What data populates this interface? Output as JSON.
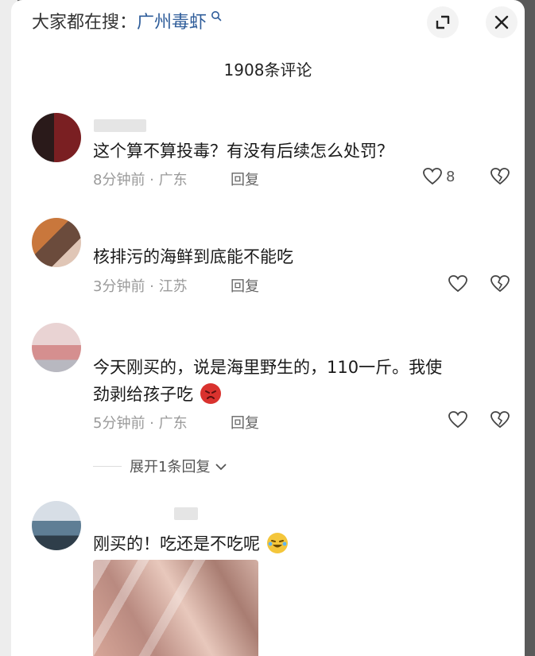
{
  "search_hint": {
    "prefix": "大家都在搜：",
    "keyword": "广州毒虾"
  },
  "comment_count_title": "1908条评论",
  "comments": [
    {
      "text": "这个算不算投毒？有没有后续怎么处罚？",
      "meta": "8分钟前 · 广东",
      "reply_label": "回复",
      "likes": "8"
    },
    {
      "text": "核排污的海鲜到底能不能吃",
      "meta": "3分钟前 · 江苏",
      "reply_label": "回复",
      "likes": ""
    },
    {
      "text_line1": "今天刚买的，说是海里野生的，110一斤。我使",
      "text_line2": "劲剥给孩子吃",
      "meta": "5分钟前 · 广东",
      "reply_label": "回复",
      "likes": "",
      "expand_replies": "展开1条回复"
    },
    {
      "text": "刚买的！吃还是不吃呢"
    }
  ],
  "colors": {
    "accent_keyword": "#2f5d9a",
    "meta_gray": "#9a9a9a"
  }
}
